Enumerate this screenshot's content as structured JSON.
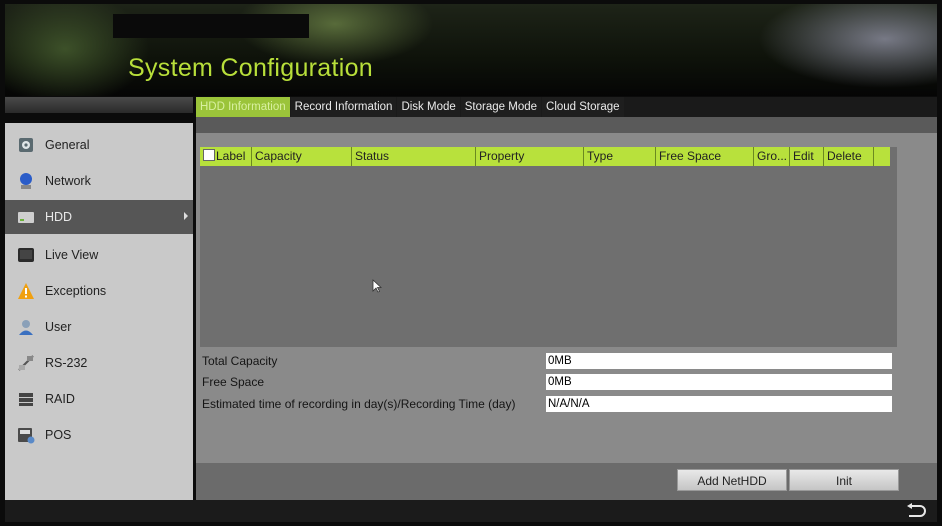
{
  "app": {
    "title": "System Configuration"
  },
  "tabs": [
    {
      "label": "HDD Information",
      "active": true
    },
    {
      "label": "Record Information",
      "active": false
    },
    {
      "label": "Disk Mode",
      "active": false
    },
    {
      "label": "Storage Mode",
      "active": false
    },
    {
      "label": "Cloud Storage",
      "active": false
    }
  ],
  "sidebar": {
    "items": [
      {
        "label": "General",
        "icon": "general-icon"
      },
      {
        "label": "Network",
        "icon": "network-icon"
      },
      {
        "label": "HDD",
        "icon": "hdd-icon",
        "active": true
      },
      {
        "label": "Live View",
        "icon": "live-view-icon"
      },
      {
        "label": "Exceptions",
        "icon": "warning-icon"
      },
      {
        "label": "User",
        "icon": "user-icon"
      },
      {
        "label": "RS-232",
        "icon": "rs232-icon"
      },
      {
        "label": "RAID",
        "icon": "raid-icon"
      },
      {
        "label": "POS",
        "icon": "pos-icon"
      }
    ]
  },
  "table": {
    "columns": [
      "Label",
      "Capacity",
      "Status",
      "Property",
      "Type",
      "Free Space",
      "Gro...",
      "Edit",
      "Delete"
    ],
    "rows": []
  },
  "info": {
    "total_capacity_label": "Total Capacity",
    "total_capacity_value": "0MB",
    "free_space_label": "Free Space",
    "free_space_value": "0MB",
    "est_time_label": "Estimated time of recording in day(s)/Recording Time (day)",
    "est_time_value": "N/A/N/A"
  },
  "buttons": {
    "add_nethdd": "Add NetHDD",
    "init": "Init"
  },
  "colors": {
    "accent": "#b8e13c",
    "title": "#b8df3a",
    "active_tab": "#9bc43a"
  }
}
